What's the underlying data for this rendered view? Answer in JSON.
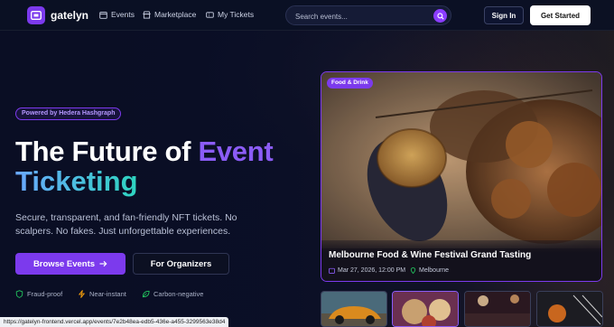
{
  "nav": {
    "brand": "gatelyn",
    "links": [
      {
        "label": "Events",
        "icon": "calendar-icon"
      },
      {
        "label": "Marketplace",
        "icon": "store-icon"
      },
      {
        "label": "My Tickets",
        "icon": "ticket-icon"
      }
    ],
    "search_placeholder": "Search events...",
    "sign_in": "Sign In",
    "get_started": "Get Started"
  },
  "hero": {
    "pill": "Powered by Hedera Hashgraph",
    "title_part1": "The Future of ",
    "title_accent": "Event",
    "title_line2": "Ticketing",
    "subtitle": "Secure, transparent, and fan-friendly NFT tickets. No scalpers. No fakes. Just unforgettable experiences.",
    "browse_button": "Browse Events",
    "organizers_button": "For Organizers",
    "features": [
      {
        "label": "Fraud-proof",
        "icon": "shield-icon",
        "color": "#22c55e"
      },
      {
        "label": "Near-instant",
        "icon": "bolt-icon",
        "color": "#f59e0b"
      },
      {
        "label": "Carbon-negative",
        "icon": "leaf-icon",
        "color": "#22c55e"
      }
    ]
  },
  "featured": {
    "category": "Food & Drink",
    "title": "Melbourne Food & Wine Festival Grand Tasting",
    "date": "Mar 27, 2026, 12:00 PM",
    "location": "Melbourne"
  },
  "thumbnails": [
    {
      "subject": "car"
    },
    {
      "subject": "food"
    },
    {
      "subject": "concert"
    },
    {
      "subject": "basketball"
    }
  ],
  "status_url": "https://gatelyn-frontend.vercel.app/events/7e2b48ea-edb5-436e-a455-3299563e38d4",
  "colors": {
    "accent": "#7c3aed",
    "background": "#0b1024",
    "gradient_start": "#6aa8ff",
    "gradient_end": "#2dd4bf"
  }
}
